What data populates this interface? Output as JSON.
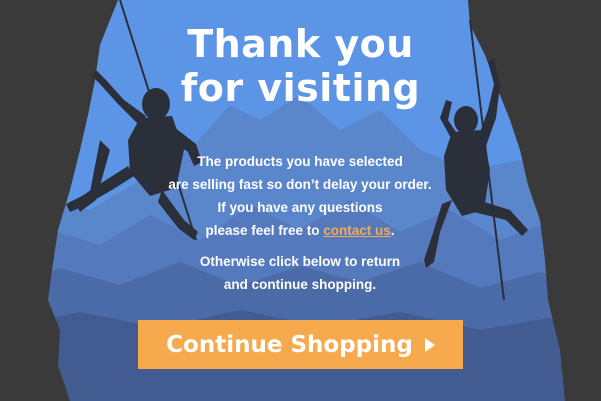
{
  "heading": {
    "line1": "Thank you",
    "line2": "for visiting"
  },
  "message": {
    "line1": "The products you have selected",
    "line2": "are selling fast so don’t delay your order.",
    "line3": "If you have any questions",
    "line4_before": "please feel free to ",
    "contact_link": "contact us",
    "line4_after": "."
  },
  "message2": {
    "line1": "Otherwise click below to return",
    "line2": "and continue shopping."
  },
  "cta": {
    "label": "Continue Shopping",
    "icon": "play-arrow-icon"
  },
  "colors": {
    "sky": "#5d95e6",
    "accent": "#f7a94d",
    "rock": "#3a3a3a",
    "text": "#ffffff"
  }
}
